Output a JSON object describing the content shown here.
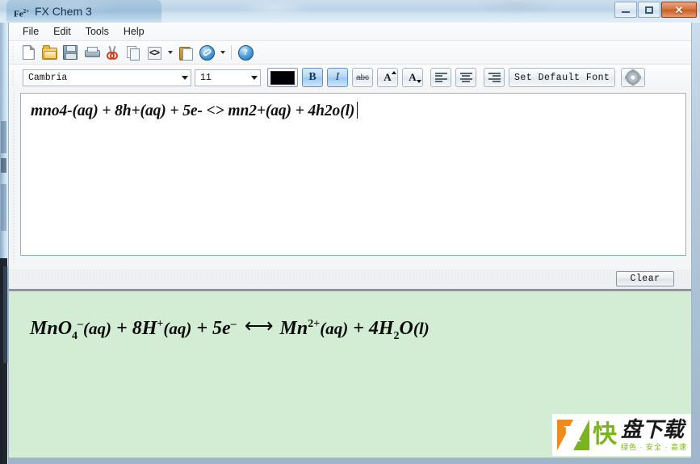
{
  "window": {
    "title": "FX Chem 3",
    "app_icon_label": "Fe",
    "app_icon_charge": "2+",
    "controls": {
      "minimize": "Minimize",
      "maximize": "Maximize",
      "close": "✕"
    }
  },
  "menubar": {
    "items": [
      {
        "label": "File",
        "name": "menu-file"
      },
      {
        "label": "Edit",
        "name": "menu-edit"
      },
      {
        "label": "Tools",
        "name": "menu-tools"
      },
      {
        "label": "Help",
        "name": "menu-help"
      }
    ]
  },
  "toolbar": {
    "items": [
      {
        "name": "new-document-icon",
        "tooltip": "New"
      },
      {
        "name": "open-folder-icon",
        "tooltip": "Open"
      },
      {
        "name": "save-icon",
        "tooltip": "Save"
      },
      {
        "name": "print-icon",
        "tooltip": "Print"
      },
      {
        "name": "cut-scissors-icon",
        "tooltip": "Cut"
      },
      {
        "name": "copy-icon",
        "tooltip": "Copy"
      },
      {
        "name": "insert-code-icon",
        "tooltip": "Insert",
        "glyph": "<>"
      },
      {
        "name": "paste-clipboard-icon",
        "tooltip": "Paste"
      },
      {
        "name": "web-globe-icon",
        "tooltip": "Web"
      },
      {
        "name": "help-icon",
        "tooltip": "Help",
        "glyph": "?"
      }
    ]
  },
  "formatbar": {
    "font_name": "Cambria",
    "font_size": "11",
    "text_color": "#000000",
    "bold_label": "B",
    "bold_active": true,
    "italic_label": "I",
    "italic_active": true,
    "strikethrough_label": "abc",
    "superscript_label": "A",
    "subscript_label": "A",
    "align_left_label": "Align Left",
    "align_center_label": "Align Center",
    "align_right_label": "Align Right",
    "set_default_font_label": "Set Default Font",
    "settings_label": "Settings"
  },
  "editor": {
    "input_text": "mno4-(aq) + 8h+(aq) + 5e- <> mn2+(aq) + 4h2o(l)",
    "clear_label": "Clear"
  },
  "output": {
    "equation_plain": "MnO4-(aq) + 8H+(aq) + 5e- <-> Mn2+(aq) + 4H2O(l)",
    "background_color": "#d2edd3",
    "tokens": [
      {
        "t": "MnO",
        "k": "base"
      },
      {
        "t": "4",
        "k": "sub"
      },
      {
        "t": "–",
        "k": "sup"
      },
      {
        "t": "(aq)",
        "k": "phase"
      },
      {
        "t": " + 8H",
        "k": "base"
      },
      {
        "t": "+",
        "k": "sup"
      },
      {
        "t": "(aq)",
        "k": "phase"
      },
      {
        "t": " + 5e",
        "k": "base"
      },
      {
        "t": "–",
        "k": "sup"
      },
      {
        "t": "⟷",
        "k": "arrow"
      },
      {
        "t": "Mn",
        "k": "base"
      },
      {
        "t": "2+",
        "k": "sup"
      },
      {
        "t": "(aq)",
        "k": "phase"
      },
      {
        "t": " + 4H",
        "k": "base"
      },
      {
        "t": "2",
        "k": "sub"
      },
      {
        "t": "O",
        "k": "base"
      },
      {
        "t": "(l)",
        "k": "phase"
      }
    ]
  },
  "watermark": {
    "k_letter": "K",
    "word_green": "快",
    "word_black": "盘下载",
    "tagline": "绿色 · 安全 · 高速"
  }
}
